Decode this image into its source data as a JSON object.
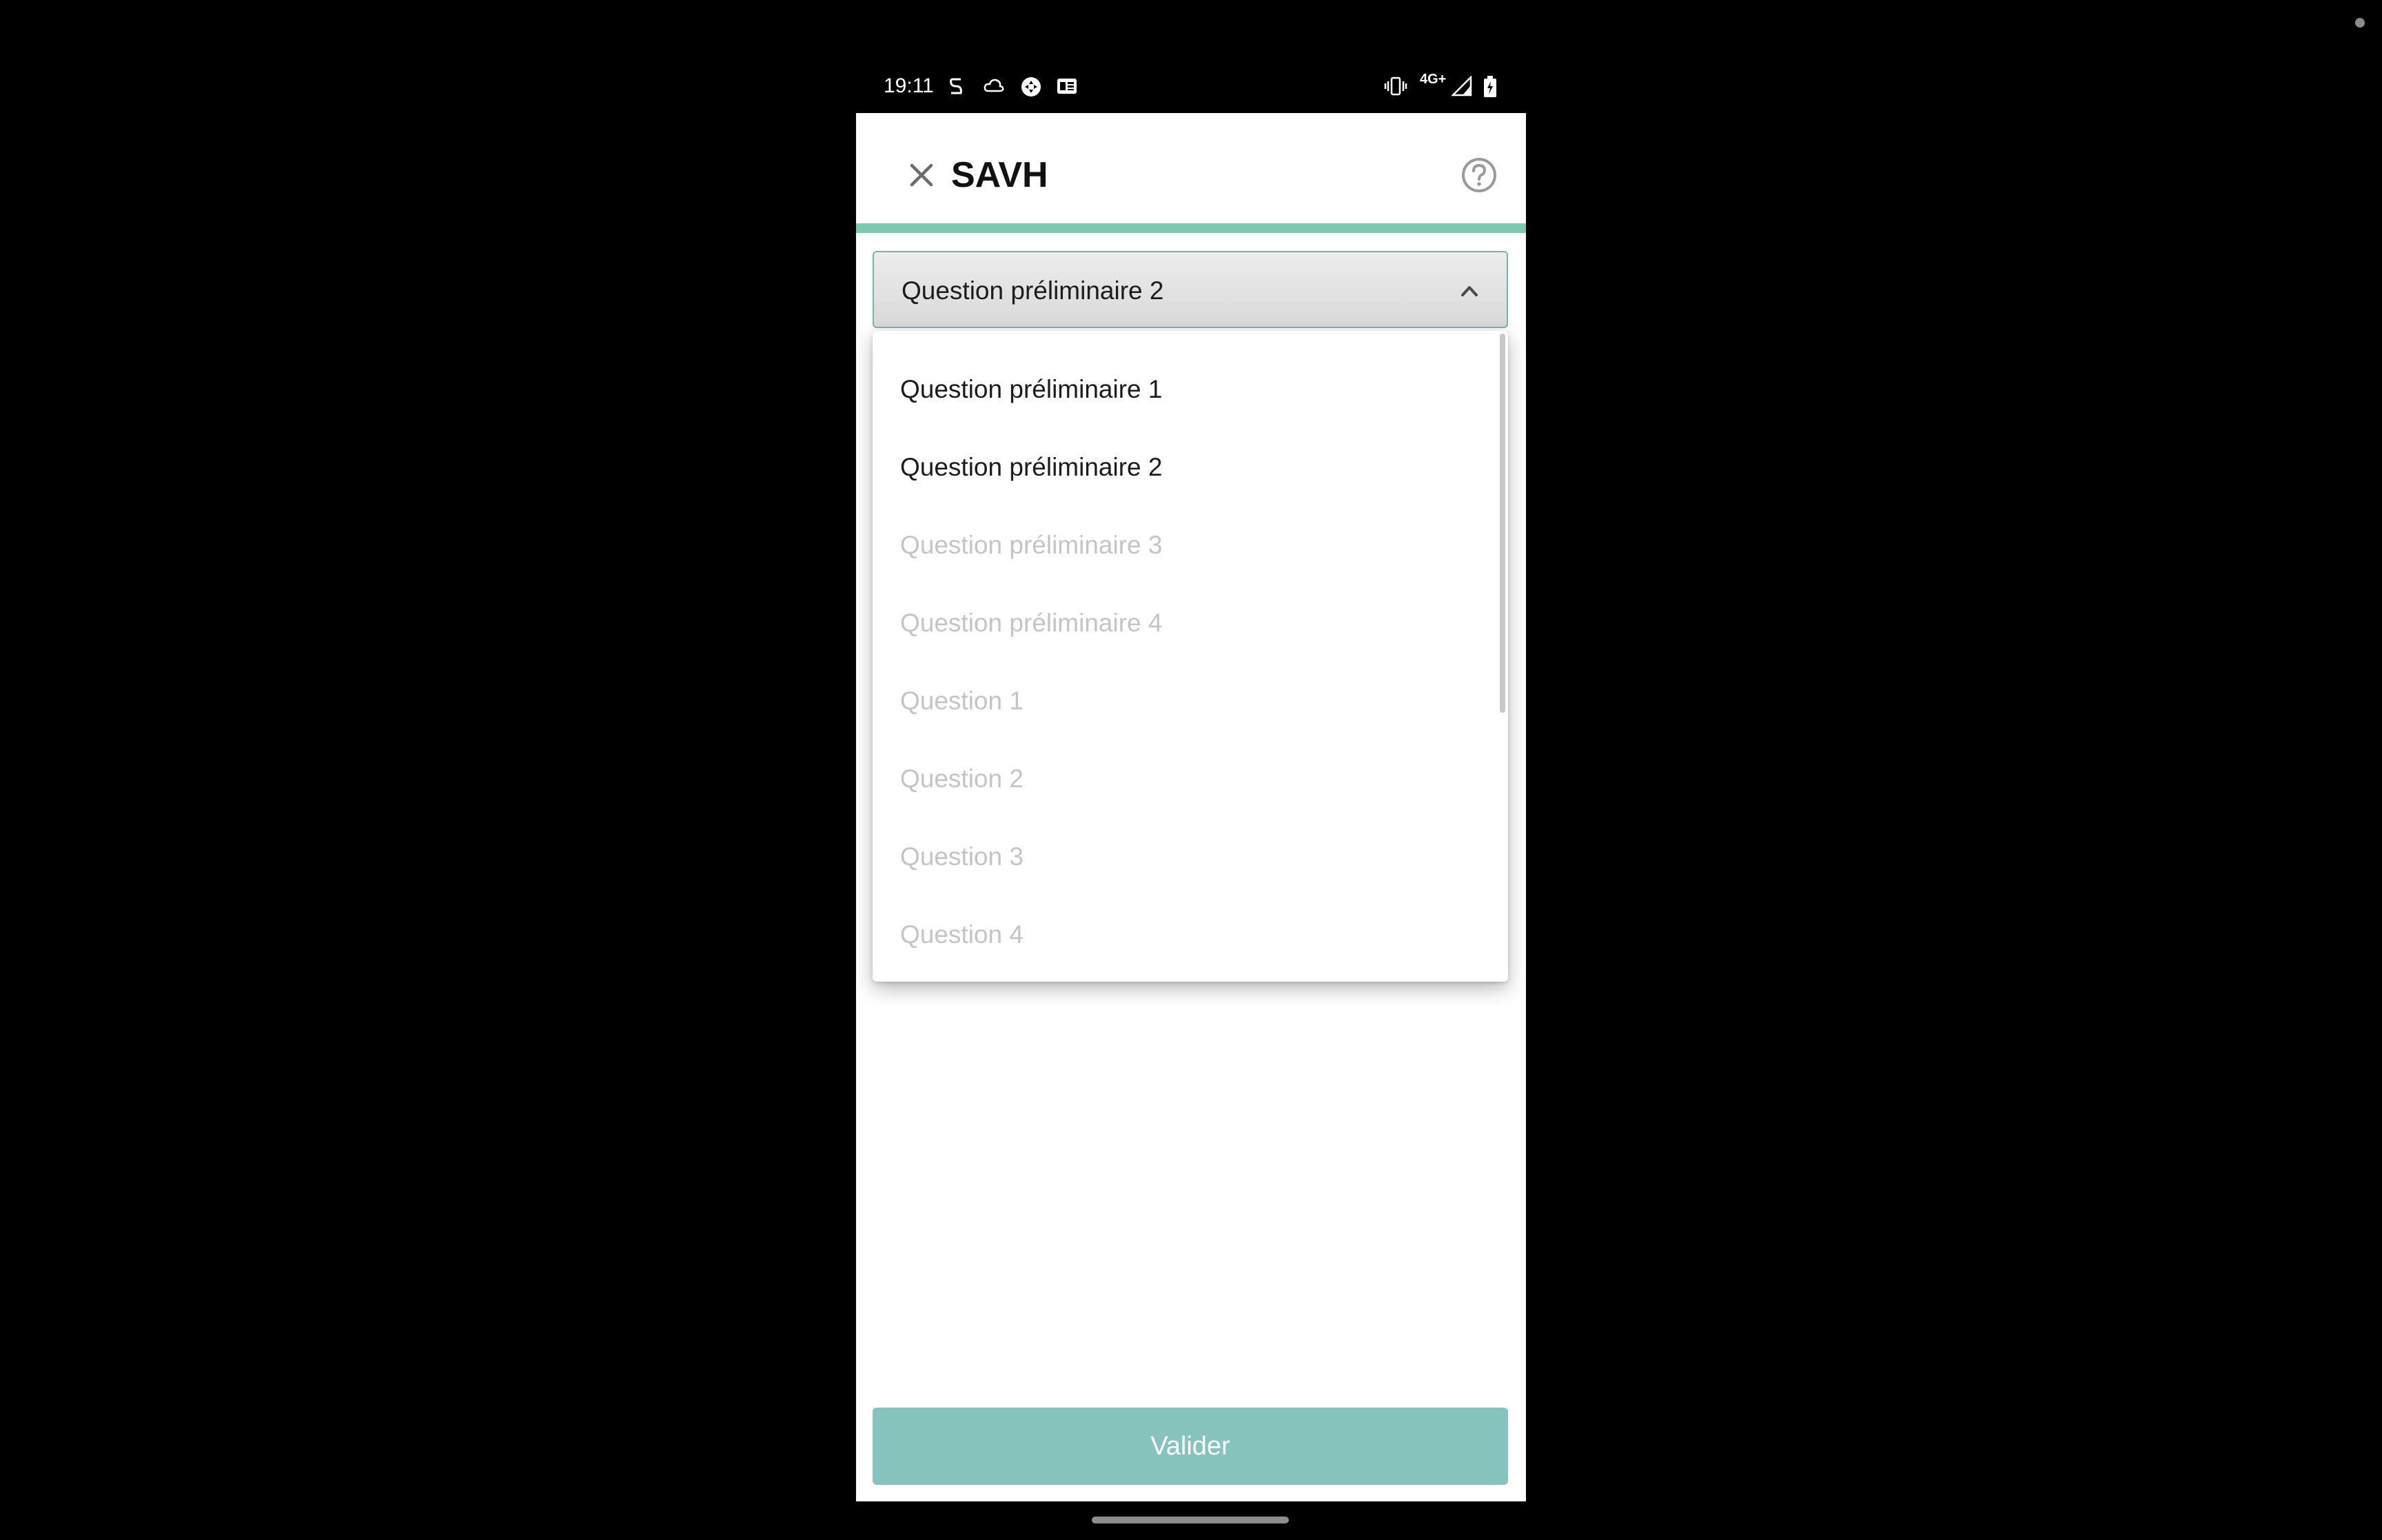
{
  "status_bar": {
    "time": "19:11",
    "left_icons": [
      "s-app-icon",
      "cloud-icon",
      "game-controller-icon",
      "news-icon"
    ],
    "right_icons": [
      "vibrate-icon",
      "network-4g-icon",
      "signal-icon",
      "battery-icon"
    ],
    "network_label": "4G+"
  },
  "app_bar": {
    "title": "SAVH",
    "close_icon": "close-icon",
    "help_icon": "help-circle-icon"
  },
  "progress": {
    "fraction": 1.0,
    "color": "#7ec9ad"
  },
  "question_dropdown": {
    "selected_value": "Question préliminaire 2",
    "expanded": true,
    "border_color": "#6fb8aa",
    "options": [
      {
        "label": "Question préliminaire 1",
        "enabled": true
      },
      {
        "label": "Question préliminaire 2",
        "enabled": true
      },
      {
        "label": "Question préliminaire 3",
        "enabled": false
      },
      {
        "label": "Question préliminaire 4",
        "enabled": false
      },
      {
        "label": "Question 1",
        "enabled": false
      },
      {
        "label": "Question 2",
        "enabled": false
      },
      {
        "label": "Question 3",
        "enabled": false
      },
      {
        "label": "Question 4",
        "enabled": false
      }
    ]
  },
  "submit": {
    "label": "Valider",
    "color": "#86c3bd"
  }
}
